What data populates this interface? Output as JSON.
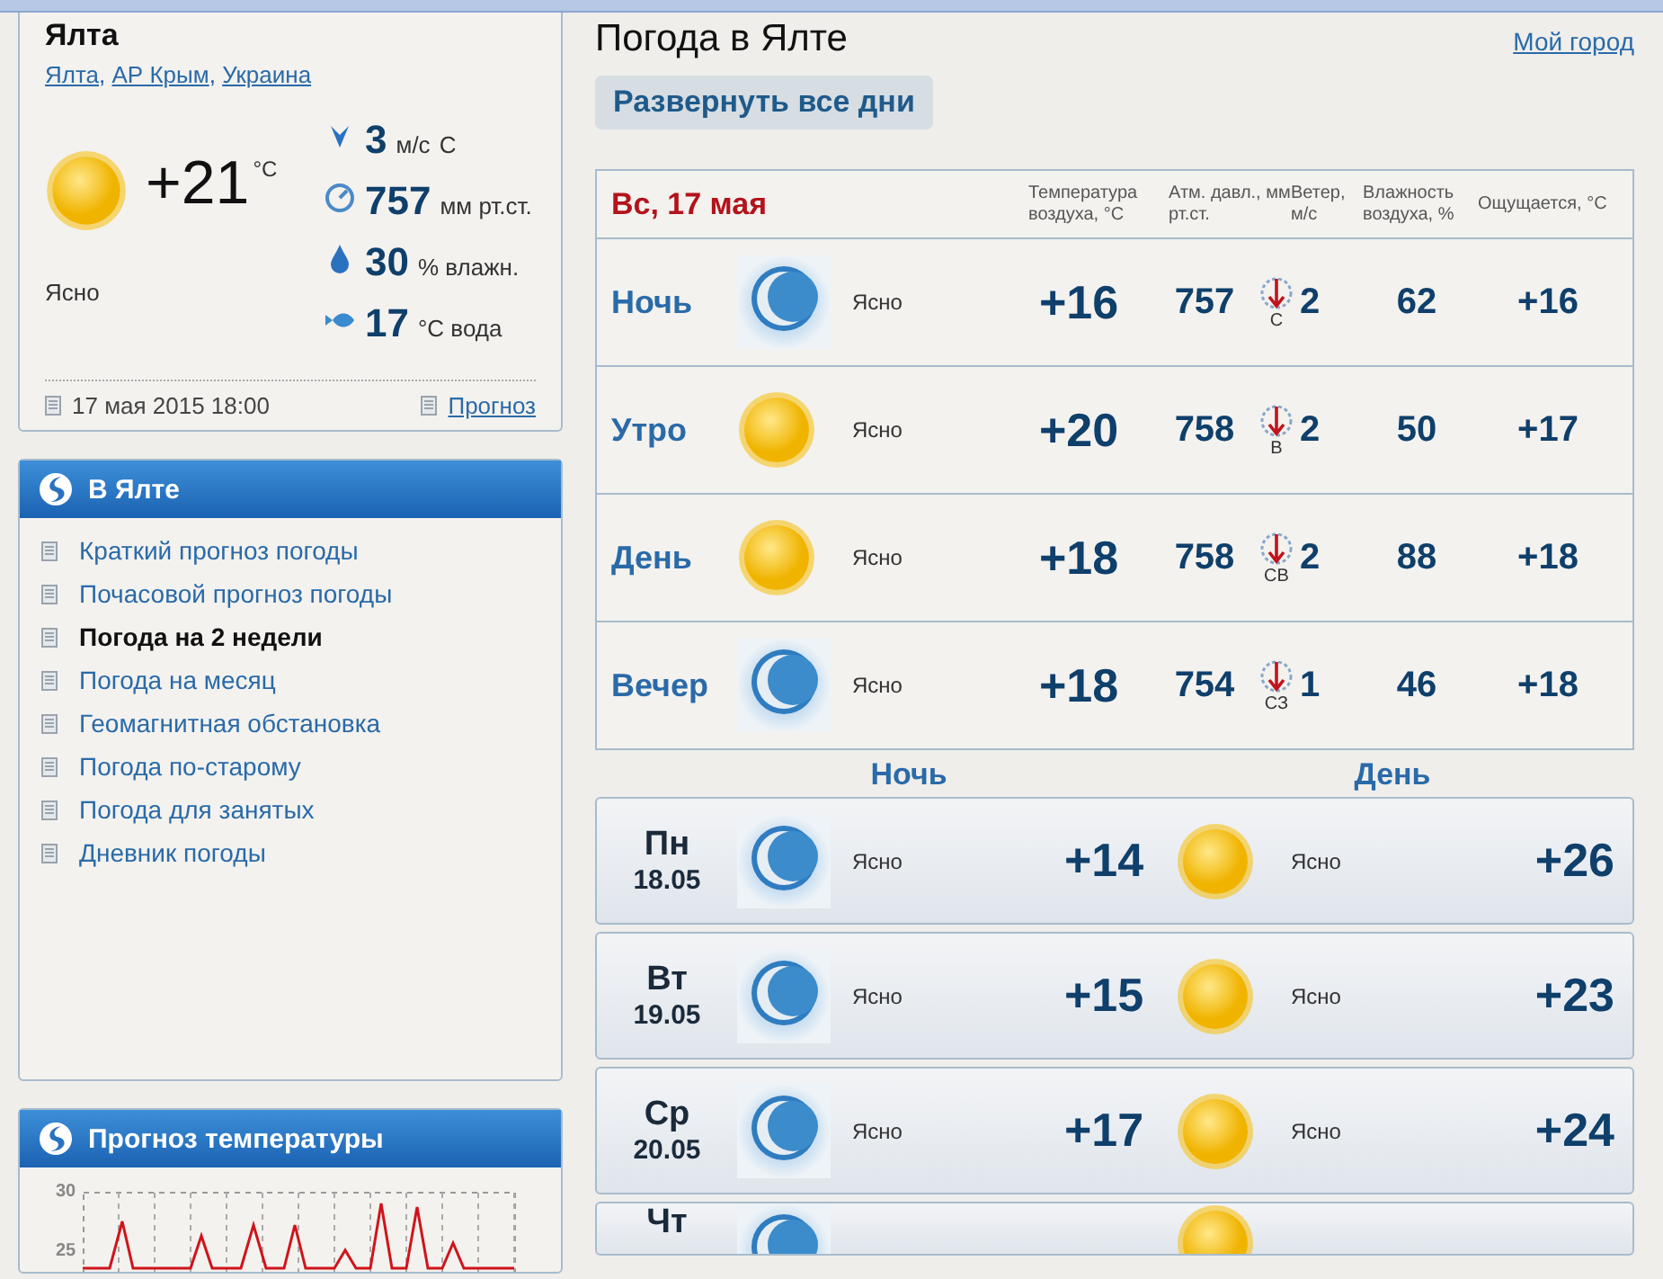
{
  "current": {
    "city": "Ялта",
    "breadcrumbs": [
      "Ялта",
      "АР Крым",
      "Украина"
    ],
    "separator": ",",
    "temperature": "+21",
    "unit": "°C",
    "condition": "Ясно",
    "kind": "sun",
    "stats": [
      {
        "kind": "wind",
        "value": "3",
        "unit": "м/с",
        "extra": "С"
      },
      {
        "kind": "pressure",
        "value": "757",
        "unit": "мм рт.ст."
      },
      {
        "kind": "humidity",
        "value": "30",
        "unit": "% влажн."
      },
      {
        "kind": "water",
        "value": "17",
        "unit": "°С вода"
      }
    ],
    "updated": "17 мая 2015 18:00",
    "forecast_link": "Прогноз"
  },
  "menu": {
    "title": "В Ялте",
    "items": [
      {
        "label": "Краткий прогноз погоды",
        "selected": false
      },
      {
        "label": "Почасовой прогноз погоды",
        "selected": false
      },
      {
        "label": "Погода на 2 недели",
        "selected": true
      },
      {
        "label": "Погода на месяц",
        "selected": false
      },
      {
        "label": "Геомагнитная обстановка",
        "selected": false
      },
      {
        "label": "Погода по-старому",
        "selected": false
      },
      {
        "label": "Погода для занятых",
        "selected": false
      },
      {
        "label": "Дневник погоды",
        "selected": false
      }
    ]
  },
  "temp_chart": {
    "title": "Прогноз температуры",
    "yticks": [
      "30",
      "25"
    ]
  },
  "main": {
    "title": "Погода в Ялте",
    "my_city": "Мой город",
    "expand_button": "Развернуть все дни",
    "today": {
      "date": "Вс, 17 мая",
      "columns": [
        "Температура воздуха, °С",
        "Атм. давл., мм рт.ст.",
        "Ветер, м/с",
        "Влажность воздуха, %",
        "Ощущается, °С"
      ],
      "rows": [
        {
          "part": "Ночь",
          "kind": "moon",
          "condition": "Ясно",
          "temp": "+16",
          "pressure": "757",
          "wind_dir": "С",
          "wind_speed": "2",
          "humidity": "62",
          "feels": "+16"
        },
        {
          "part": "Утро",
          "kind": "sun",
          "condition": "Ясно",
          "temp": "+20",
          "pressure": "758",
          "wind_dir": "В",
          "wind_speed": "2",
          "humidity": "50",
          "feels": "+17"
        },
        {
          "part": "День",
          "kind": "sun",
          "condition": "Ясно",
          "temp": "+18",
          "pressure": "758",
          "wind_dir": "СВ",
          "wind_speed": "2",
          "humidity": "88",
          "feels": "+18"
        },
        {
          "part": "Вечер",
          "kind": "moon",
          "condition": "Ясно",
          "temp": "+18",
          "pressure": "754",
          "wind_dir": "СЗ",
          "wind_speed": "1",
          "humidity": "46",
          "feels": "+18"
        }
      ]
    },
    "days": {
      "columns": [
        "Ночь",
        "День"
      ],
      "rows": [
        {
          "day": "Пн",
          "date": "18.05",
          "night": {
            "kind": "moon",
            "condition": "Ясно",
            "temp": "+14"
          },
          "daytime": {
            "kind": "sun",
            "condition": "Ясно",
            "temp": "+26"
          }
        },
        {
          "day": "Вт",
          "date": "19.05",
          "night": {
            "kind": "moon",
            "condition": "Ясно",
            "temp": "+15"
          },
          "daytime": {
            "kind": "sun",
            "condition": "Ясно",
            "temp": "+23"
          }
        },
        {
          "day": "Ср",
          "date": "20.05",
          "night": {
            "kind": "moon",
            "condition": "Ясно",
            "temp": "+17"
          },
          "daytime": {
            "kind": "sun",
            "condition": "Ясно",
            "temp": "+24"
          }
        },
        {
          "day": "Чт",
          "night": {
            "kind": "moon"
          },
          "daytime": {
            "kind": "sun"
          }
        }
      ]
    }
  }
}
